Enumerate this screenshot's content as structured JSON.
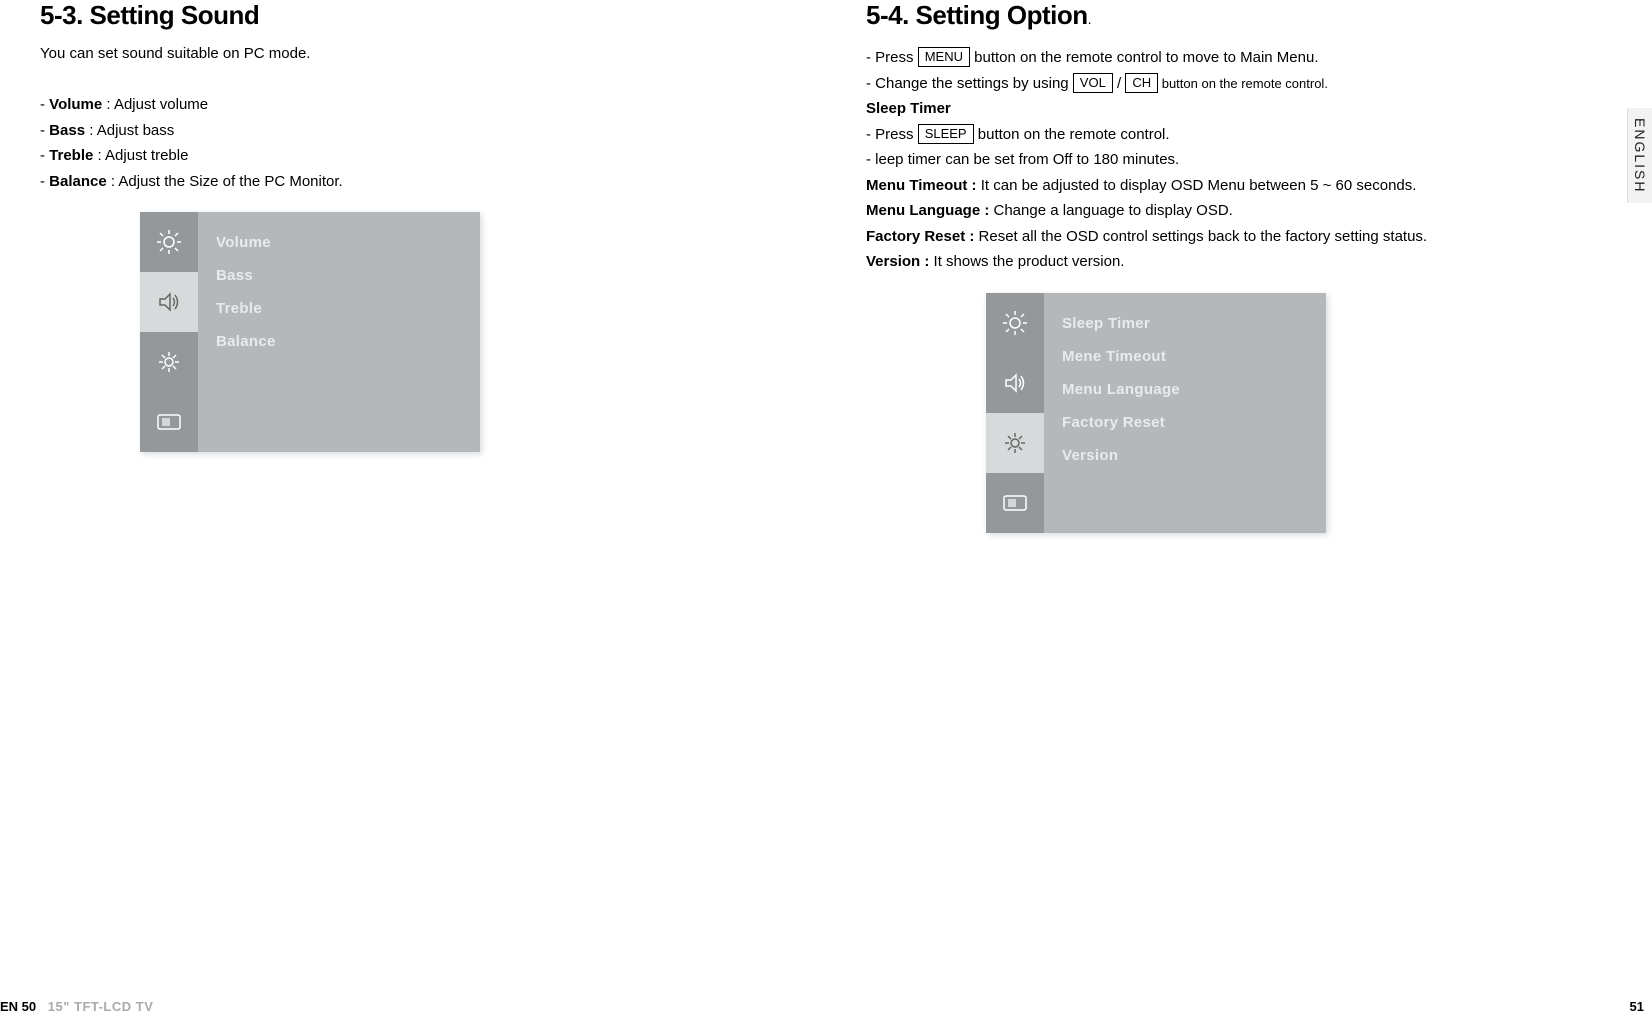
{
  "left": {
    "heading": "5-3. Setting Sound",
    "intro": "You can set sound suitable on PC mode.",
    "items": [
      {
        "label": "Volume",
        "desc": "Adjust volume"
      },
      {
        "label": "Bass",
        "desc": "Adjust bass"
      },
      {
        "label": "Treble",
        "desc": "Adjust treble"
      },
      {
        "label": "Balance",
        "desc": "Adjust the Size of the PC Monitor."
      }
    ],
    "menu": [
      "Volume",
      "Bass",
      "Treble",
      "Balance"
    ]
  },
  "right": {
    "heading": "5-4. Setting Option",
    "press_prefix": "- Press ",
    "menu_btn": "MENU",
    "press_suffix": " button on the remote control to move to Main Menu.",
    "change_prefix": "- Change the settings by using ",
    "vol_btn": "VOL",
    "slash": " / ",
    "ch_btn": "CH",
    "change_suffix": " button on the remote control.",
    "sleep_heading": "Sleep Timer",
    "sleep_press_prefix": "- Press ",
    "sleep_btn": "SLEEP",
    "sleep_press_suffix": " button on the remote control.",
    "sleep_range": "- leep timer can be set from Off to 180 minutes.",
    "timeout_label": "Menu Timeout :",
    "timeout_desc": " It can be adjusted to display OSD Menu between 5 ~ 60 seconds.",
    "lang_label": "Menu Language :",
    "lang_desc": " Change a language to display OSD.",
    "reset_label": "Factory Reset :",
    "reset_desc": " Reset all the OSD control settings back to the factory setting status.",
    "version_label": "Version :",
    "version_desc": " It shows the product version.",
    "menu": [
      "Sleep Timer",
      "Mene Timeout",
      "Menu Language",
      "Factory Reset",
      "Version"
    ]
  },
  "side_tab": "ENGLISH",
  "footer": {
    "left_page": "EN 50",
    "left_sub": "15\" TFT-LCD TV",
    "right_page": "51"
  }
}
